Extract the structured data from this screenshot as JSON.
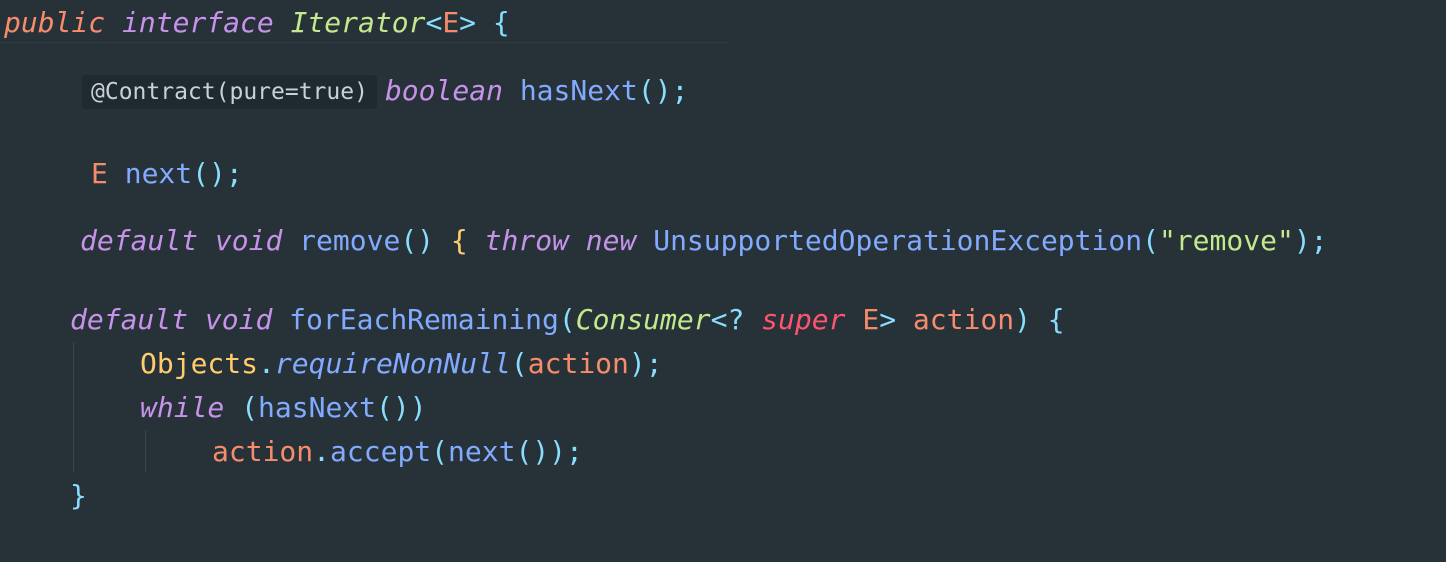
{
  "code": {
    "line1": {
      "kw_public": "public",
      "kw_interface": "interface",
      "name": "Iterator",
      "lt": "<",
      "tparam": "E",
      "gt": ">",
      "brace": "{"
    },
    "line2": {
      "annotation": "@Contract(pure=true)",
      "type": "boolean",
      "method": "hasNext",
      "parens": "();"
    },
    "line3": {
      "type": "E",
      "method": "next",
      "parens": "();"
    },
    "line4": {
      "kw_default": "default",
      "kw_void": "void",
      "method": "remove",
      "parens": "()",
      "brace": "{",
      "kw_throw": "throw",
      "kw_new": "new",
      "exception": "UnsupportedOperationException",
      "open": "(",
      "string": "\"remove\"",
      "close": ");"
    },
    "line5": {
      "kw_default": "default",
      "kw_void": "void",
      "method": "forEachRemaining",
      "open": "(",
      "ptype": "Consumer",
      "wild": "<?",
      "kw_super": "super",
      "tparam": "E",
      "gt": ">",
      "param": "action",
      "close": ")",
      "brace": "{"
    },
    "line6": {
      "cls": "Objects",
      "dot": ".",
      "method": "requireNonNull",
      "open": "(",
      "arg": "action",
      "close": ");"
    },
    "line7": {
      "kw_while": "while",
      "open": "(",
      "method": "hasNext",
      "close": "())"
    },
    "line8": {
      "obj": "action",
      "dot": ".",
      "method": "accept",
      "open": "(",
      "inner": "next",
      "close": "());"
    },
    "line9": {
      "brace": "}"
    }
  }
}
